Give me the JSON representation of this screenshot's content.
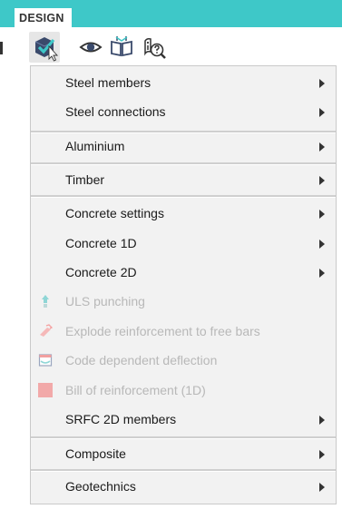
{
  "ribbon": {
    "tab_label": "DESIGN"
  },
  "toolbar": {
    "icons": [
      "design-check-icon",
      "eye-icon",
      "book-icon",
      "info-help-icon"
    ]
  },
  "menu": {
    "items": [
      {
        "label": "Steel members",
        "enabled": true,
        "submenu": true
      },
      {
        "label": "Steel connections",
        "enabled": true,
        "submenu": true
      },
      {
        "label": "Aluminium",
        "enabled": true,
        "submenu": true
      },
      {
        "label": "Timber",
        "enabled": true,
        "submenu": true
      },
      {
        "label": "Concrete settings",
        "enabled": true,
        "submenu": true
      },
      {
        "label": "Concrete 1D",
        "enabled": true,
        "submenu": true
      },
      {
        "label": "Concrete 2D",
        "enabled": true,
        "submenu": true
      },
      {
        "label": "ULS punching",
        "enabled": false,
        "submenu": false,
        "icon": "punching-icon"
      },
      {
        "label": "Explode reinforcement to free bars",
        "enabled": false,
        "submenu": false,
        "icon": "explode-bars-icon"
      },
      {
        "label": "Code dependent deflection",
        "enabled": false,
        "submenu": false,
        "icon": "deflection-icon"
      },
      {
        "label": "Bill of reinforcement (1D)",
        "enabled": false,
        "submenu": false,
        "icon": "bill-icon"
      },
      {
        "label": "SRFC 2D members",
        "enabled": true,
        "submenu": true
      },
      {
        "label": "Composite",
        "enabled": true,
        "submenu": true
      },
      {
        "label": "Geotechnics",
        "enabled": true,
        "submenu": true
      }
    ]
  },
  "colors": {
    "accent": "#3ec8c8",
    "menu_bg": "#f2f2f2",
    "disabled_text": "#b8b8b8"
  }
}
